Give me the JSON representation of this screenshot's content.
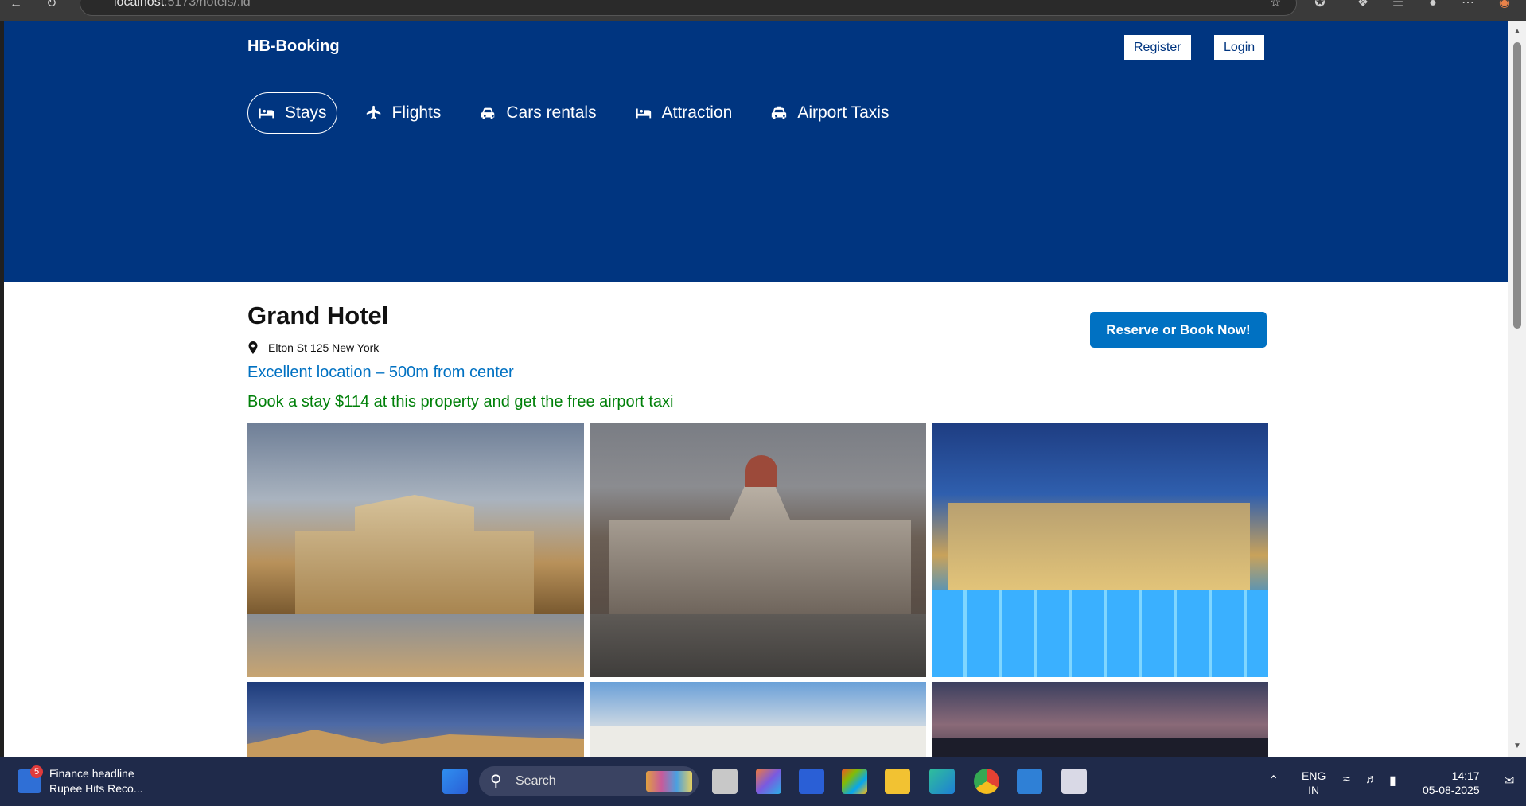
{
  "browser": {
    "url_host": "localhost",
    "url_path": ":5173/hotels/:id"
  },
  "header": {
    "brand": "HB-Booking",
    "register_label": "Register",
    "login_label": "Login",
    "nav": [
      {
        "label": "Stays",
        "icon": "bed-icon",
        "active": true
      },
      {
        "label": "Flights",
        "icon": "plane-icon",
        "active": false
      },
      {
        "label": "Cars rentals",
        "icon": "car-icon",
        "active": false
      },
      {
        "label": "Attraction",
        "icon": "bed-icon",
        "active": false
      },
      {
        "label": "Airport Taxis",
        "icon": "taxi-icon",
        "active": false
      }
    ]
  },
  "hotel": {
    "name": "Grand Hotel",
    "address": "Elton St 125 New York",
    "location_note": "Excellent location – 500m from center",
    "offer_note": "Book a stay $114 at this property and get the free airport taxi",
    "book_button_label": "Reserve or Book Now!"
  },
  "colors": {
    "header_bg": "#003580",
    "brand_blue": "#0071c2",
    "offer_green": "#008009"
  },
  "taskbar": {
    "news_badge": "5",
    "news_title": "Finance headline",
    "news_subtitle": "Rupee Hits Reco...",
    "search_label": "Search",
    "lang_line1": "ENG",
    "lang_line2": "IN",
    "time": "14:17",
    "date": "05-08-2025"
  }
}
